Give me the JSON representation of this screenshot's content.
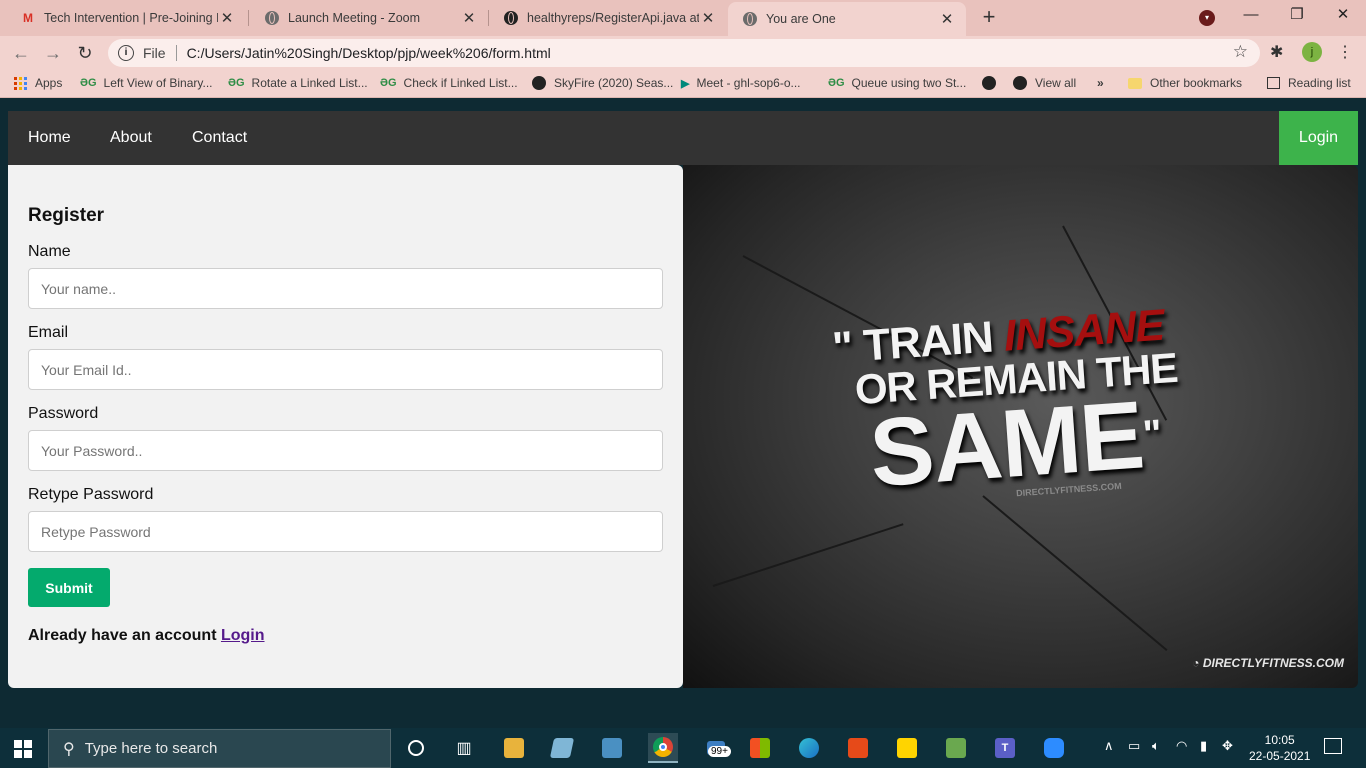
{
  "browser": {
    "tabs": [
      {
        "title": "Tech Intervention | Pre-Joining Le",
        "favicon": "gmail-icon"
      },
      {
        "title": "Launch Meeting - Zoom",
        "favicon": "globe-icon"
      },
      {
        "title": "healthyreps/RegisterApi.java at p",
        "favicon": "github-icon"
      },
      {
        "title": "You are One",
        "favicon": "globe-icon",
        "active": true
      }
    ],
    "address": {
      "scheme": "File",
      "url": "C:/Users/Jatin%20Singh/Desktop/pjp/week%206/form.html"
    },
    "profile_initial": "j",
    "bookmarks": [
      {
        "label": "Apps"
      },
      {
        "label": "Left View of Binary..."
      },
      {
        "label": "Rotate a Linked List..."
      },
      {
        "label": "Check if Linked List..."
      },
      {
        "label": "SkyFire (2020) Seas..."
      },
      {
        "label": "Meet - ghl-sop6-o..."
      },
      {
        "label": "Queue using two St..."
      },
      {
        "label": "View all"
      },
      {
        "label": "»"
      },
      {
        "label": "Other bookmarks"
      },
      {
        "label": "Reading list"
      }
    ]
  },
  "page": {
    "nav": {
      "home": "Home",
      "about": "About",
      "contact": "Contact",
      "login": "Login"
    },
    "form": {
      "title": "Register",
      "name_label": "Name",
      "name_placeholder": "Your name..",
      "email_label": "Email",
      "email_placeholder": "Your Email Id..",
      "password_label": "Password",
      "password_placeholder": "Your Password..",
      "retype_label": "Retype Password",
      "retype_placeholder": "Retype Password",
      "submit": "Submit",
      "account_text": "Already have an account",
      "account_link": "Login"
    },
    "poster": {
      "quote_open": "\"",
      "train": "TRAIN",
      "insane": "INSANE",
      "or_remain_the": "OR REMAIN THE",
      "same": "SAME",
      "quote_close": "\"",
      "site": "DIRECTLYFITNESS.COM",
      "brand": "DIRECTLYFITNESS.COM"
    }
  },
  "taskbar": {
    "search_placeholder": "Type here to search",
    "mail_badge": "99+",
    "time": "10:05",
    "date": "22-05-2021"
  },
  "colors": {
    "nav_bg": "#333333",
    "login_green": "#3db34b",
    "submit_green": "#04aa6d",
    "insane_red": "#a50f0f"
  }
}
